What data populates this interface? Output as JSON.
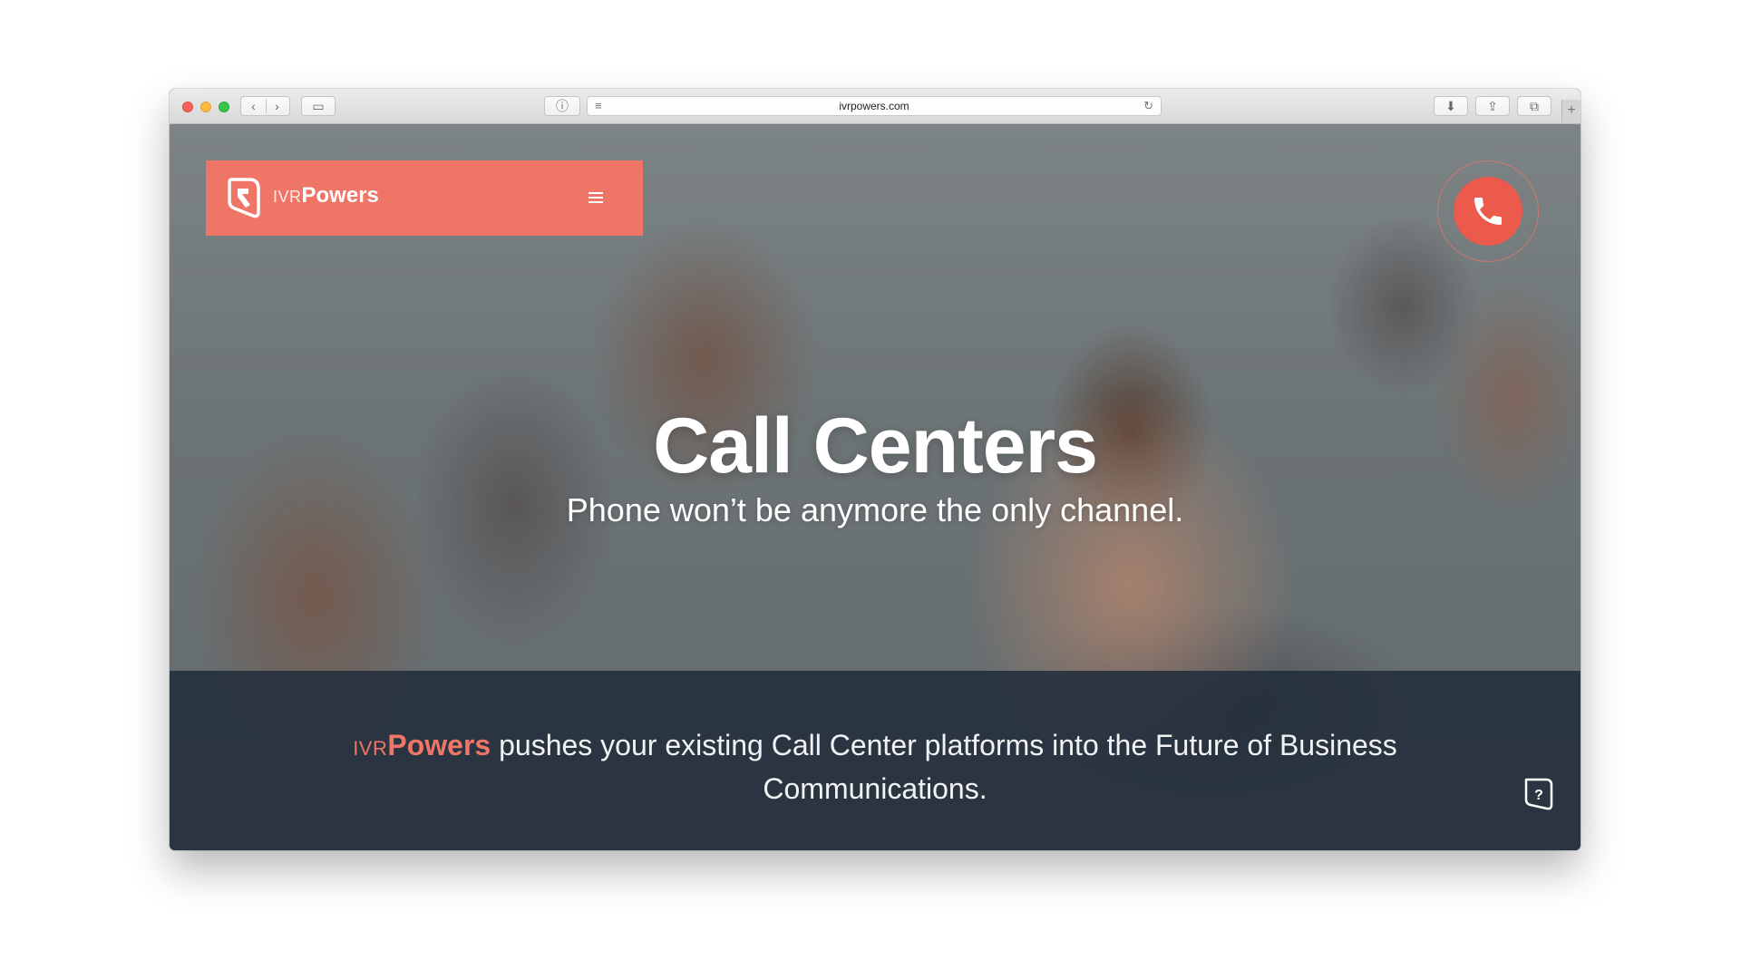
{
  "browser": {
    "url": "ivrpowers.com",
    "back_icon": "‹",
    "forward_icon": "›",
    "sidebar_icon": "▭",
    "info_icon": "ⓘ",
    "reader_icon": "≡",
    "reload_icon": "↻",
    "download_icon": "⬇",
    "share_icon": "⇪",
    "tabs_icon": "⧉",
    "new_tab_icon": "+"
  },
  "header": {
    "brand_prefix": "IVR",
    "brand_name": "Powers",
    "accent_color": "#ef7566"
  },
  "hero": {
    "title": "Call Centers",
    "subtitle": "Phone won’t be anymore the only channel."
  },
  "band": {
    "brand_prefix": "IVR",
    "brand_name": "Powers",
    "text": " pushes your existing Call Center platforms into the Future of Business Communications.",
    "background_color": "#212c3a"
  },
  "icons": {
    "logo": "logo-icon",
    "menu": "hamburger-menu-icon",
    "phone": "phone-icon",
    "help": "help-icon"
  }
}
